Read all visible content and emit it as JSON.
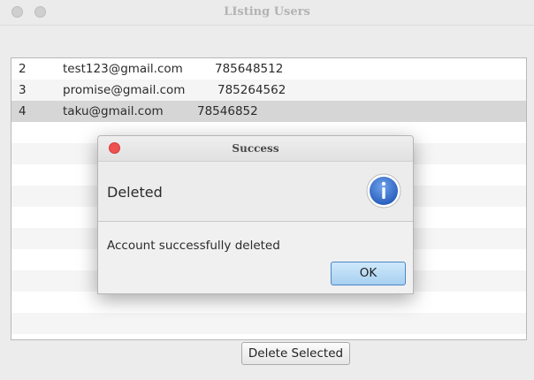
{
  "window": {
    "title": "LIsting Users"
  },
  "table": {
    "rows": [
      {
        "id": "2",
        "email": "test123@gmail.com",
        "phone": "785648512"
      },
      {
        "id": "3",
        "email": "promise@gmail.com",
        "phone": "785264562"
      },
      {
        "id": "4",
        "email": "taku@gmail.com",
        "phone": "78546852",
        "selected": true
      }
    ]
  },
  "actions": {
    "delete_label": "Delete Selected"
  },
  "dialog": {
    "title": "Success",
    "heading": "Deleted",
    "message": "Account successfully deleted",
    "ok_label": "OK",
    "icon": "info-icon"
  },
  "colors": {
    "selected_row": "#d6d6d6",
    "alt_row": "#f5f5f5",
    "close_button": "#ee4f4f",
    "ok_button": "#a7d0f0",
    "info_icon": "#2f6fd1"
  }
}
